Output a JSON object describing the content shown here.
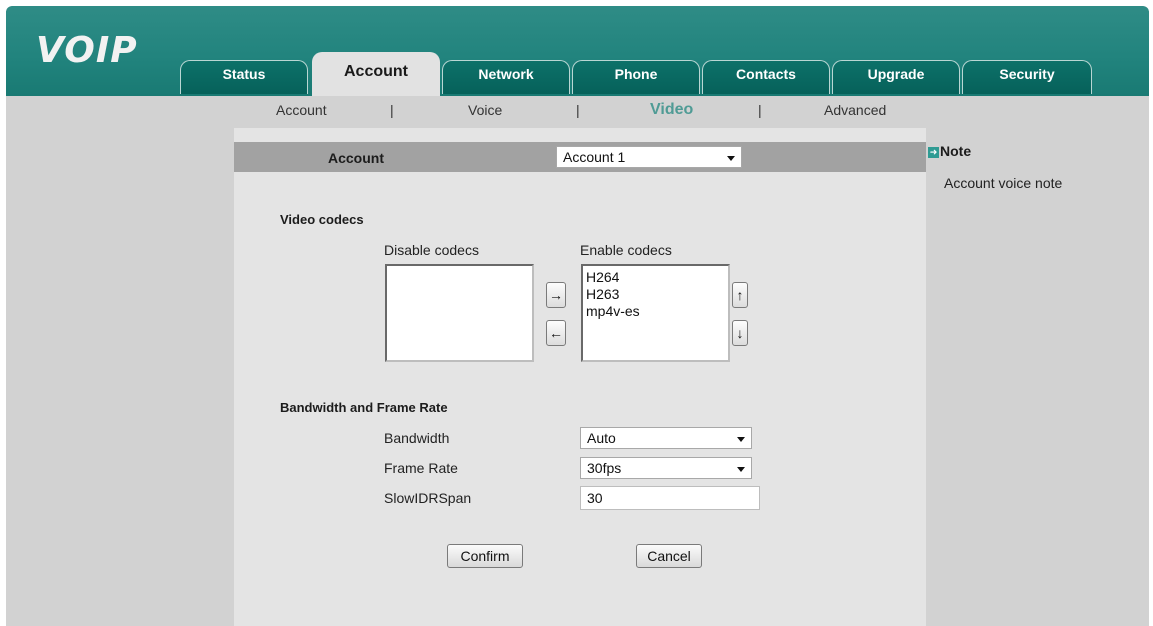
{
  "app": {
    "logo": "VOIP"
  },
  "tabs": [
    {
      "label": "Status"
    },
    {
      "label": "Account"
    },
    {
      "label": "Network"
    },
    {
      "label": "Phone"
    },
    {
      "label": "Contacts"
    },
    {
      "label": "Upgrade"
    },
    {
      "label": "Security"
    }
  ],
  "subnav": {
    "items": [
      "Account",
      "Voice",
      "Video",
      "Advanced"
    ],
    "separator": "|",
    "active": "Video"
  },
  "account_bar": {
    "label": "Account",
    "selected": "Account 1"
  },
  "video_codecs": {
    "title": "Video codecs",
    "disable_label": "Disable codecs",
    "enable_label": "Enable codecs",
    "disabled": [],
    "enabled": [
      "H264",
      "H263",
      "mp4v-es"
    ],
    "move_right_icon": "→",
    "move_left_icon": "←",
    "move_up_icon": "↑",
    "move_down_icon": "↓"
  },
  "bandwidth": {
    "title": "Bandwidth and Frame Rate",
    "bandwidth_label": "Bandwidth",
    "bandwidth_value": "Auto",
    "framerate_label": "Frame Rate",
    "framerate_value": "30fps",
    "slowidr_label": "SlowIDRSpan",
    "slowidr_value": "30"
  },
  "buttons": {
    "confirm": "Confirm",
    "cancel": "Cancel"
  },
  "note": {
    "icon": "arrow-right-icon",
    "title": "Note",
    "text": "Account voice note"
  },
  "colors": {
    "header": "#22847e",
    "active_subnav": "#4f9b95",
    "background": "#d2d2d2"
  }
}
